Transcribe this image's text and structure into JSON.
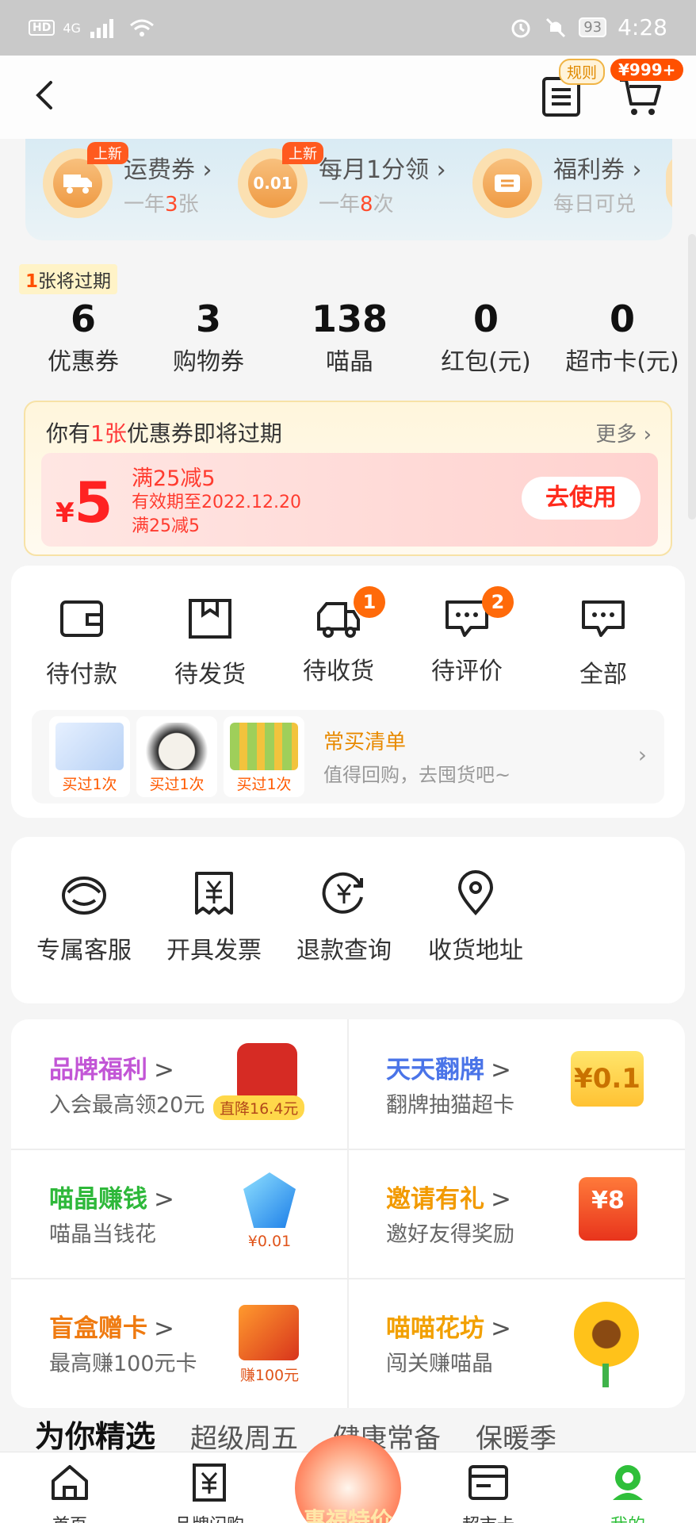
{
  "status": {
    "time": "4:28",
    "battery": "93",
    "network": "4G",
    "hd": "HD"
  },
  "header": {
    "rule_badge": "规则",
    "price_badge": "¥999+"
  },
  "benefits": [
    {
      "title": "运费券",
      "sub_prefix": "一年",
      "sub_num": "3",
      "sub_suffix": "张",
      "badge": "上新",
      "icon_text": ""
    },
    {
      "title": "每月1分领",
      "sub_prefix": "一年",
      "sub_num": "8",
      "sub_suffix": "次",
      "badge": "上新",
      "icon_text": "0.01"
    },
    {
      "title": "福利券",
      "sub_prefix": "每日可兑",
      "sub_num": "",
      "sub_suffix": "",
      "badge": "",
      "icon_text": ""
    }
  ],
  "expire_tip": {
    "num": "1",
    "text": "张将过期"
  },
  "stats": [
    {
      "value": "6",
      "label": "优惠券"
    },
    {
      "value": "3",
      "label": "购物券"
    },
    {
      "value": "138",
      "label": "喵晶"
    },
    {
      "value": "0",
      "label": "红包(元)"
    },
    {
      "value": "0",
      "label": "超市卡(元)"
    }
  ],
  "coupon": {
    "title_prefix": "你有",
    "title_count": "1张",
    "title_suffix": "优惠券即将过期",
    "more": "更多",
    "yen": "¥",
    "amount": "5",
    "line1": "满25减5",
    "line2": "有效期至2022.12.20",
    "line3": "满25减5",
    "use_button": "去使用"
  },
  "orders": [
    {
      "label": "待付款",
      "badge": ""
    },
    {
      "label": "待发货",
      "badge": ""
    },
    {
      "label": "待收货",
      "badge": "1"
    },
    {
      "label": "待评价",
      "badge": "2"
    },
    {
      "label": "全部",
      "badge": ""
    }
  ],
  "buy_list": {
    "title": "常买清单",
    "subtitle": "值得回购，去囤货吧~",
    "arrow": "›",
    "items": [
      {
        "tag": "买过1次"
      },
      {
        "tag": "买过1次"
      },
      {
        "tag": "买过1次"
      }
    ]
  },
  "services": [
    {
      "label": "专属客服",
      "icon": "headset-icon"
    },
    {
      "label": "开具发票",
      "icon": "invoice-icon"
    },
    {
      "label": "退款查询",
      "icon": "refund-icon"
    },
    {
      "label": "收货地址",
      "icon": "location-icon"
    }
  ],
  "promos": [
    {
      "title": "品牌福利",
      "sub": "入会最高领20元",
      "color": "#c255d6",
      "img_label": "直降16.4元"
    },
    {
      "title": "天天翻牌",
      "sub": "翻牌抽猫超卡",
      "color": "#4a74e8",
      "img_label": "¥0.1"
    },
    {
      "title": "喵晶赚钱",
      "sub": "喵晶当钱花",
      "color": "#2eb83a",
      "img_label": "¥0.01"
    },
    {
      "title": "邀请有礼",
      "sub": "邀好友得奖励",
      "color": "#f29a00",
      "img_label": "¥8"
    },
    {
      "title": "盲盒赠卡",
      "sub": "最高赚100元卡",
      "color": "#ef7a10",
      "img_label": "赚100元"
    },
    {
      "title": "喵喵花坊",
      "sub": "闯关赚喵晶",
      "color": "#f2a000",
      "img_label": ""
    }
  ],
  "rec_tabs": [
    "为你精选",
    "超级周五",
    "健康常备",
    "保暖季"
  ],
  "bottom_nav": [
    {
      "label": "首页",
      "icon": "home-icon"
    },
    {
      "label": "品牌闪购",
      "icon": "brand-icon"
    },
    {
      "label": "惠福特价",
      "icon": "center-icon"
    },
    {
      "label": "超市卡",
      "icon": "card-icon"
    },
    {
      "label": "我的",
      "icon": "profile-icon"
    }
  ]
}
